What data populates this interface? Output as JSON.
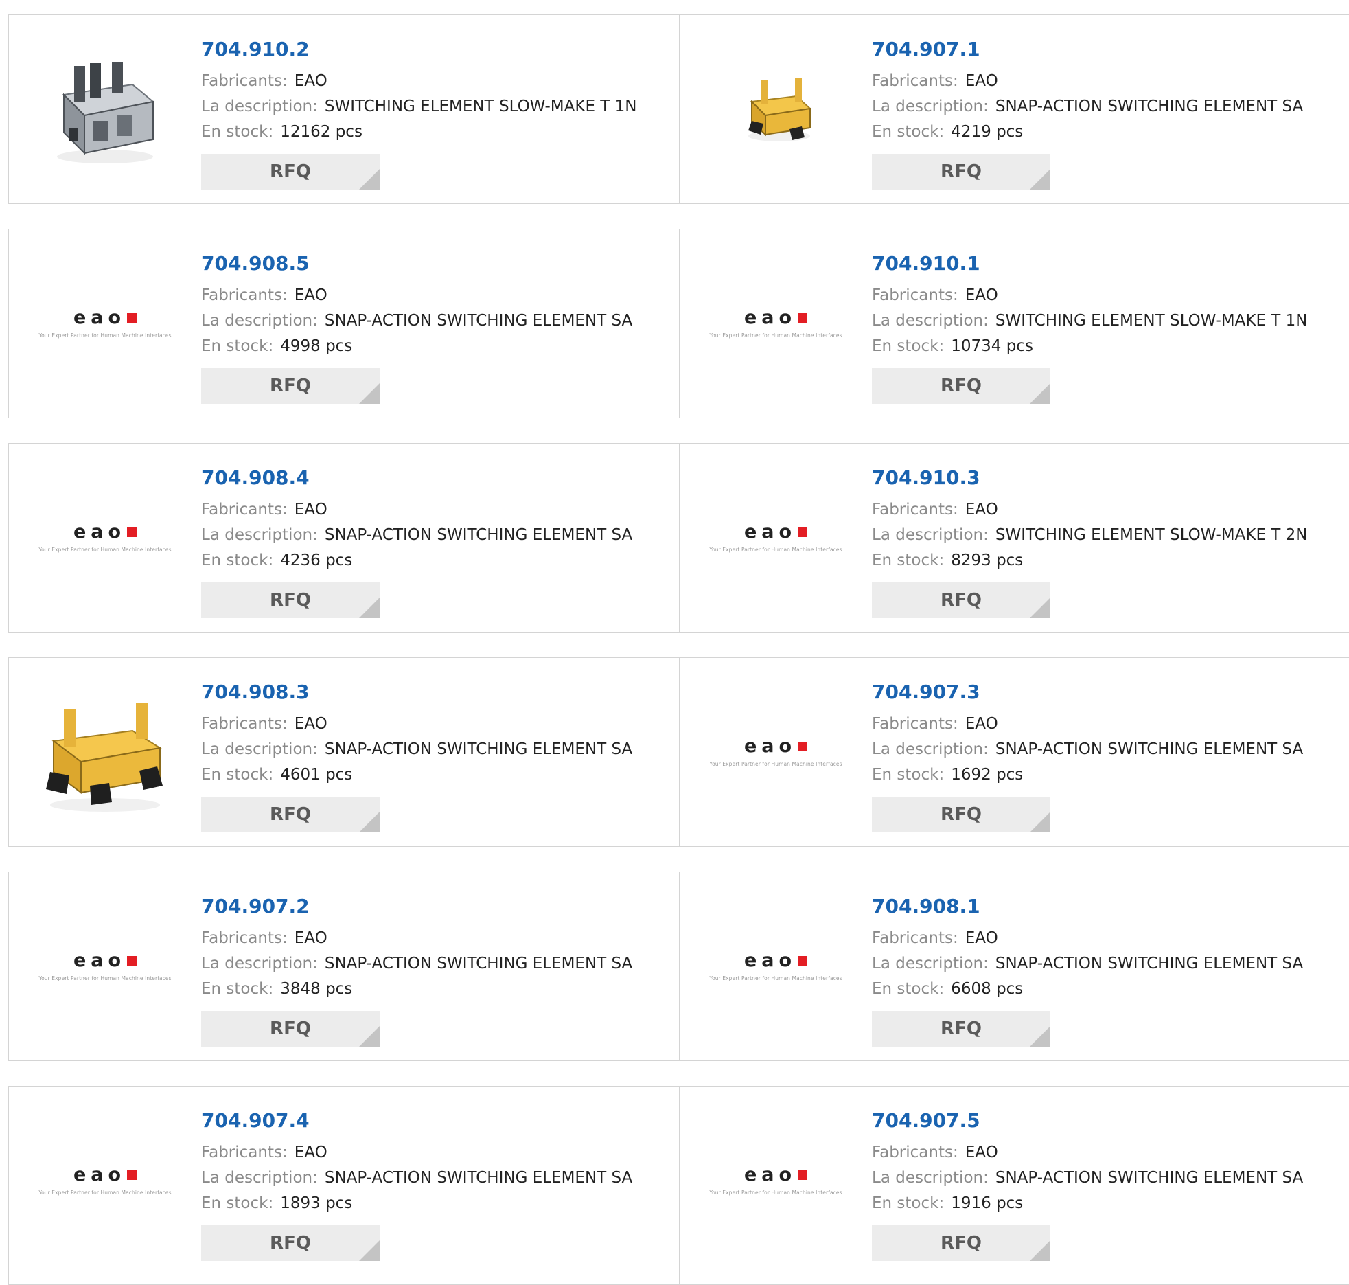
{
  "labels": {
    "manufacturer": "Fabricants:",
    "description": "La description:",
    "stock": "En stock:",
    "rfq": "RFQ"
  },
  "logo": {
    "word": "eao",
    "tagline": "Your Expert Partner for Human Machine Interfaces",
    "brand_color": "#e31e24"
  },
  "colors": {
    "link": "#1a63b0",
    "label": "#8a8a8a",
    "button_bg": "#ececec"
  },
  "products": [
    {
      "part": "704.910.2",
      "manufacturer": "EAO",
      "description": "SWITCHING ELEMENT SLOW-MAKE T 1N",
      "stock": "12162 pcs",
      "image": "photo-clear"
    },
    {
      "part": "704.907.1",
      "manufacturer": "EAO",
      "description": "SNAP-ACTION SWITCHING ELEMENT SA",
      "stock": "4219 pcs",
      "image": "photo-yellow-small"
    },
    {
      "part": "704.908.5",
      "manufacturer": "EAO",
      "description": "SNAP-ACTION SWITCHING ELEMENT SA",
      "stock": "4998 pcs",
      "image": "eao-logo"
    },
    {
      "part": "704.910.1",
      "manufacturer": "EAO",
      "description": "SWITCHING ELEMENT SLOW-MAKE T 1N",
      "stock": "10734 pcs",
      "image": "eao-logo"
    },
    {
      "part": "704.908.4",
      "manufacturer": "EAO",
      "description": "SNAP-ACTION SWITCHING ELEMENT SA",
      "stock": "4236 pcs",
      "image": "eao-logo"
    },
    {
      "part": "704.910.3",
      "manufacturer": "EAO",
      "description": "SWITCHING ELEMENT SLOW-MAKE T 2N",
      "stock": "8293 pcs",
      "image": "eao-logo"
    },
    {
      "part": "704.908.3",
      "manufacturer": "EAO",
      "description": "SNAP-ACTION SWITCHING ELEMENT SA",
      "stock": "4601 pcs",
      "image": "photo-yellow-large"
    },
    {
      "part": "704.907.3",
      "manufacturer": "EAO",
      "description": "SNAP-ACTION SWITCHING ELEMENT SA",
      "stock": "1692 pcs",
      "image": "eao-logo"
    },
    {
      "part": "704.907.2",
      "manufacturer": "EAO",
      "description": "SNAP-ACTION SWITCHING ELEMENT SA",
      "stock": "3848 pcs",
      "image": "eao-logo"
    },
    {
      "part": "704.908.1",
      "manufacturer": "EAO",
      "description": "SNAP-ACTION SWITCHING ELEMENT SA",
      "stock": "6608 pcs",
      "image": "eao-logo"
    },
    {
      "part": "704.907.4",
      "manufacturer": "EAO",
      "description": "SNAP-ACTION SWITCHING ELEMENT SA",
      "stock": "1893 pcs",
      "image": "eao-logo"
    },
    {
      "part": "704.907.5",
      "manufacturer": "EAO",
      "description": "SNAP-ACTION SWITCHING ELEMENT SA",
      "stock": "1916 pcs",
      "image": "eao-logo"
    }
  ]
}
